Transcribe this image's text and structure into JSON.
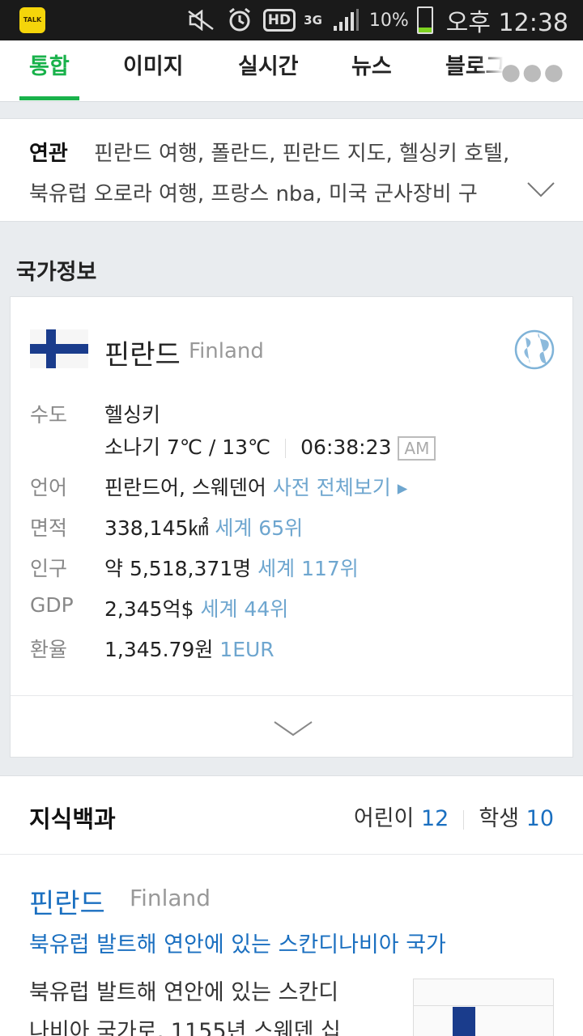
{
  "status_bar": {
    "app_icon_label": "TALK",
    "network": "3G",
    "hd_label": "HD",
    "battery_percent": "10%",
    "time": "오후 12:38"
  },
  "tabs": [
    {
      "label": "통합",
      "active": true
    },
    {
      "label": "이미지"
    },
    {
      "label": "실시간"
    },
    {
      "label": "뉴스"
    },
    {
      "label": "블로그"
    }
  ],
  "related": {
    "label": "연관",
    "line1": "핀란드 여행, 폴란드, 핀란드 지도, 헬싱키 호텔,",
    "line2": "북유럽 오로라 여행, 프랑스 nba, 미국 군사장비 구"
  },
  "country_info": {
    "section_title": "국가정보",
    "name": "핀란드",
    "name_en": "Finland",
    "rows": {
      "capital": {
        "label": "수도",
        "value": "헬싱키"
      },
      "weather": {
        "value": "소나기 7℃ / 13℃",
        "time": "06:38:23",
        "ampm": "AM"
      },
      "language": {
        "label": "언어",
        "value": "핀란드어, 스웨덴어",
        "link": "사전 전체보기 ▸"
      },
      "area": {
        "label": "면적",
        "value": "338,145㎢",
        "link": "세계 65위"
      },
      "population": {
        "label": "인구",
        "value": "약 5,518,371명",
        "link": "세계 117위"
      },
      "gdp": {
        "label": "GDP",
        "value": "2,345억$",
        "link": "세계 44위"
      },
      "exchange": {
        "label": "환율",
        "value": "1,345.79원",
        "link": "1EUR"
      }
    }
  },
  "encyclopedia": {
    "title": "지식백과",
    "kids_label": "어린이",
    "kids_count": "12",
    "student_label": "학생",
    "student_count": "10",
    "entry_name": "핀란드",
    "entry_name_en": "Finland",
    "entry_subtitle": "북유럽 발트해 연안에 있는 스칸디나비아 국가",
    "entry_desc_line1": "북유럽 발트해 연안에 있는 스칸디",
    "entry_desc_line2": "나비아 국가로, 1155년 스웨덴 십"
  },
  "colors": {
    "accent_green": "#19b24b",
    "link_blue": "#6ea6cf",
    "title_blue": "#1a6fc0"
  }
}
